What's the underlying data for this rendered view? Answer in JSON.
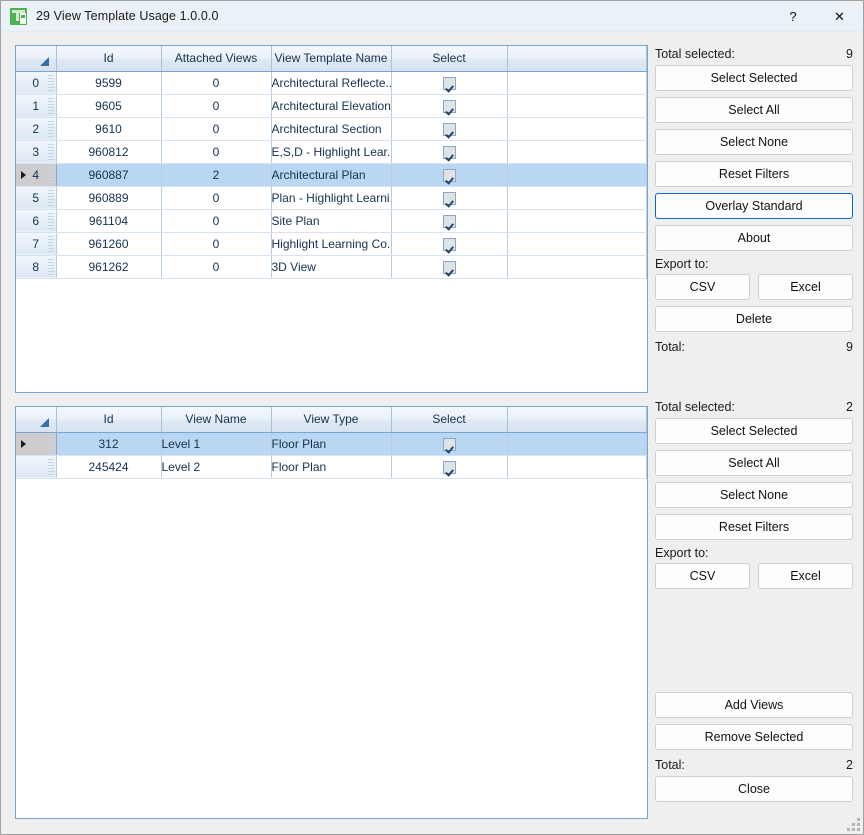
{
  "window": {
    "title": "29 View Template Usage 1.0.0.0",
    "icon": "app-green-icon",
    "help_label": "?",
    "close_label": "✕"
  },
  "grid_top": {
    "columns": [
      "Id",
      "Attached Views",
      "View Template Name",
      "Select"
    ],
    "rows": [
      {
        "index": "0",
        "id": "9599",
        "attached_views": "0",
        "name": "Architectural Reflecte...",
        "select": true,
        "selected": false
      },
      {
        "index": "1",
        "id": "9605",
        "attached_views": "0",
        "name": "Architectural Elevation",
        "select": true,
        "selected": false
      },
      {
        "index": "2",
        "id": "9610",
        "attached_views": "0",
        "name": "Architectural Section",
        "select": true,
        "selected": false
      },
      {
        "index": "3",
        "id": "960812",
        "attached_views": "0",
        "name": "E,S,D - Highlight Lear...",
        "select": true,
        "selected": false
      },
      {
        "index": "4",
        "id": "960887",
        "attached_views": "2",
        "name": "Architectural Plan",
        "select": true,
        "selected": true
      },
      {
        "index": "5",
        "id": "960889",
        "attached_views": "0",
        "name": "Plan - Highlight Learni...",
        "select": true,
        "selected": false
      },
      {
        "index": "6",
        "id": "961104",
        "attached_views": "0",
        "name": "Site Plan",
        "select": true,
        "selected": false
      },
      {
        "index": "7",
        "id": "961260",
        "attached_views": "0",
        "name": "Highlight Learning Co...",
        "select": true,
        "selected": false
      },
      {
        "index": "8",
        "id": "961262",
        "attached_views": "0",
        "name": "3D View",
        "select": true,
        "selected": false
      }
    ]
  },
  "grid_bottom": {
    "columns": [
      "Id",
      "View Name",
      "View Type",
      "Select"
    ],
    "rows": [
      {
        "index": "",
        "id": "312",
        "view_name": "Level 1",
        "view_type": "Floor Plan",
        "select": true,
        "selected": true
      },
      {
        "index": "",
        "id": "245424",
        "view_name": "Level 2",
        "view_type": "Floor Plan",
        "select": true,
        "selected": false
      }
    ]
  },
  "panel_top": {
    "total_selected_label": "Total selected:",
    "total_selected_value": "9",
    "select_selected": "Select Selected",
    "select_all": "Select All",
    "select_none": "Select None",
    "reset_filters": "Reset Filters",
    "overlay_standard": "Overlay Standard",
    "about": "About",
    "export_label": "Export to:",
    "csv": "CSV",
    "excel": "Excel",
    "delete": "Delete",
    "total_label": "Total:",
    "total_value": "9"
  },
  "panel_bottom": {
    "total_selected_label": "Total selected:",
    "total_selected_value": "2",
    "select_selected": "Select Selected",
    "select_all": "Select All",
    "select_none": "Select None",
    "reset_filters": "Reset Filters",
    "export_label": "Export to:",
    "csv": "CSV",
    "excel": "Excel",
    "add_views": "Add Views",
    "remove_selected": "Remove Selected",
    "total_label": "Total:",
    "total_value": "2",
    "close": "Close"
  },
  "colors": {
    "accent_focus": "#0a68c8",
    "row_selected": "#b9d7f2",
    "grid_border": "#7aa5cc",
    "titlebar_bg": "#eaf2f8",
    "panel_bg": "#efefef",
    "icon_green": "#4caf50"
  }
}
